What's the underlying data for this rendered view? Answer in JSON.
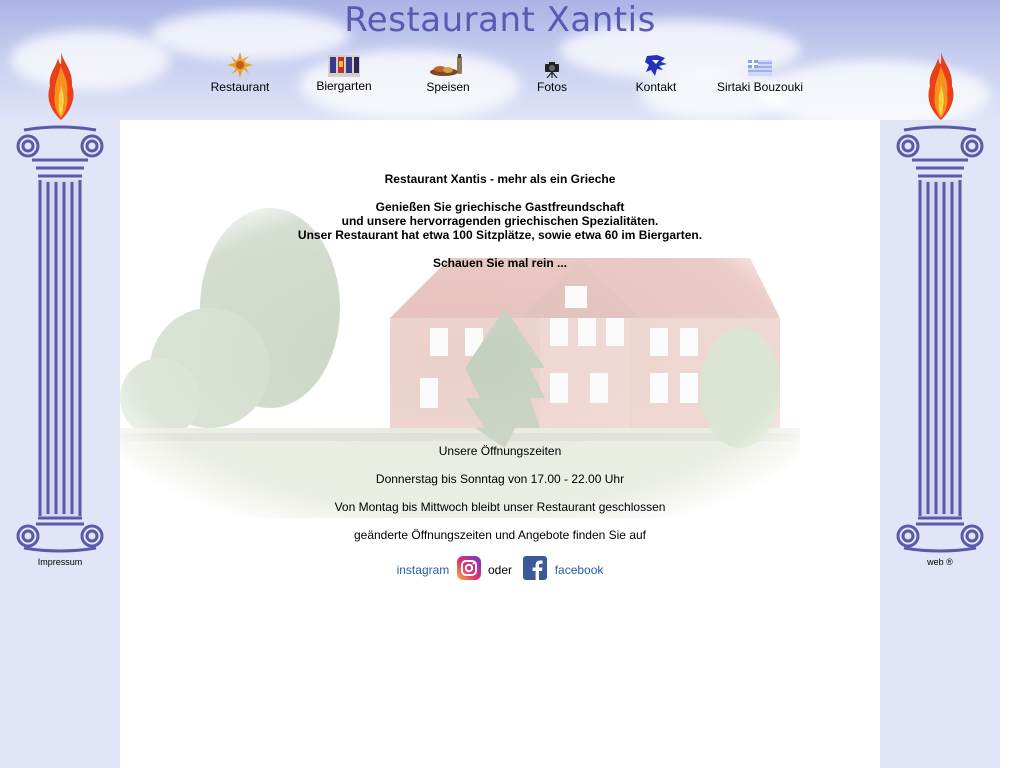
{
  "header": {
    "title": "Restaurant Xantis"
  },
  "nav": {
    "items": [
      {
        "label": "Restaurant",
        "icon": "sun-icon"
      },
      {
        "label": "Biergarten",
        "icon": "beer-garden-icon"
      },
      {
        "label": "Speisen",
        "icon": "food-icon"
      },
      {
        "label": "Fotos",
        "icon": "camera-icon"
      },
      {
        "label": "Kontakt",
        "icon": "greece-map-icon"
      },
      {
        "label": "Sirtaki Bouzouki",
        "icon": "greek-flag-icon"
      }
    ]
  },
  "sidebar": {
    "left_link": "Impressum",
    "right_link": "web ®"
  },
  "content": {
    "headline": "Restaurant Xantis - mehr als ein Grieche",
    "intro_line1": "Genießen Sie griechische Gastfreundschaft",
    "intro_line2": "und unsere hervorragenden griechischen Spezialitäten.",
    "intro_line3": "Unser Restaurant hat etwa 100 Sitzplätze, sowie etwa 60 im Biergarten.",
    "look_in": "Schauen Sie mal rein ...",
    "hours_heading": "Unsere Öffnungszeiten",
    "hours_open": "Donnerstag bis Sonntag von 17.00 - 22.00 Uhr",
    "hours_closed": "Von Montag bis Mittwoch bleibt unser Restaurant geschlossen",
    "changed_hours": "geänderte Öffnungszeiten und Angebote finden Sie auf",
    "instagram_label": "instagram",
    "or_label": "oder",
    "facebook_label": "facebook"
  },
  "colors": {
    "page_background": "#e2e4f8",
    "title": "#5a5ab0",
    "column": "#5a5aa8",
    "link": "#2b5ba8"
  }
}
